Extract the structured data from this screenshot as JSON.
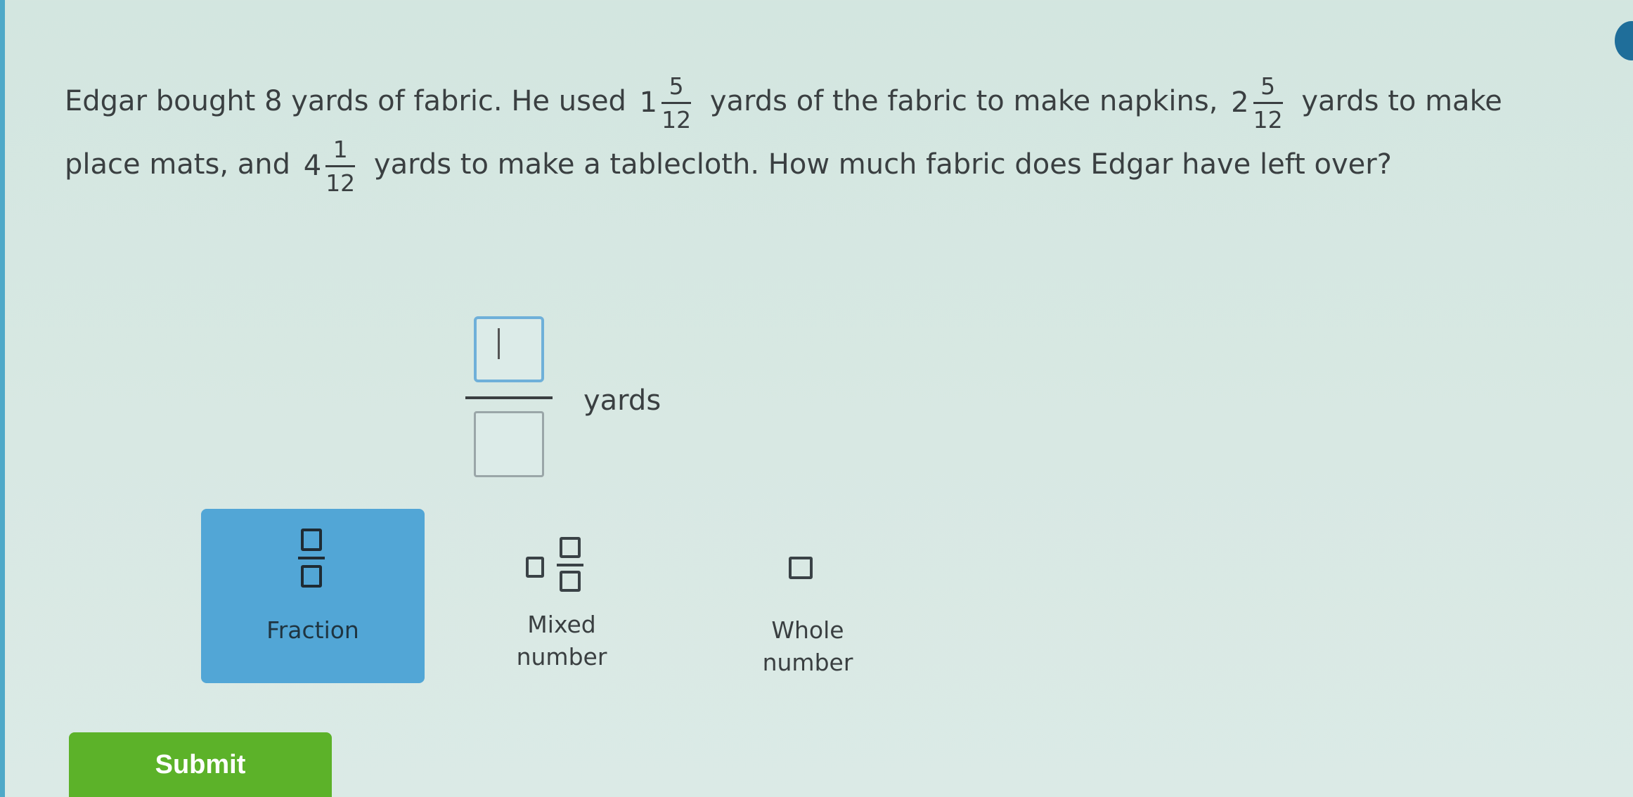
{
  "question": {
    "part1": "Edgar bought 8 yards of fabric. He used",
    "napkins_whole": "1",
    "napkins_num": "5",
    "napkins_den": "12",
    "part2": "yards of the fabric to make napkins,",
    "mats_whole": "2",
    "mats_num": "5",
    "mats_den": "12",
    "part3": "yards to make place mats, and",
    "cloth_whole": "4",
    "cloth_num": "1",
    "cloth_den": "12",
    "part4": "yards to make a tablecloth. How much fabric does Edgar have left over?"
  },
  "answer": {
    "numerator_value": "",
    "denominator_value": "",
    "unit": "yards"
  },
  "answer_types": [
    {
      "label": "Fraction",
      "selected": true
    },
    {
      "label_line1": "Mixed",
      "label_line2": "number",
      "selected": false
    },
    {
      "label_line1": "Whole",
      "label_line2": "number",
      "selected": false
    }
  ],
  "submit": {
    "label": "Submit"
  },
  "colors": {
    "background": "#d6e8e2",
    "selected_button": "#52a6d6",
    "submit_button": "#5cb229",
    "active_input_border": "#6fb0d9"
  }
}
